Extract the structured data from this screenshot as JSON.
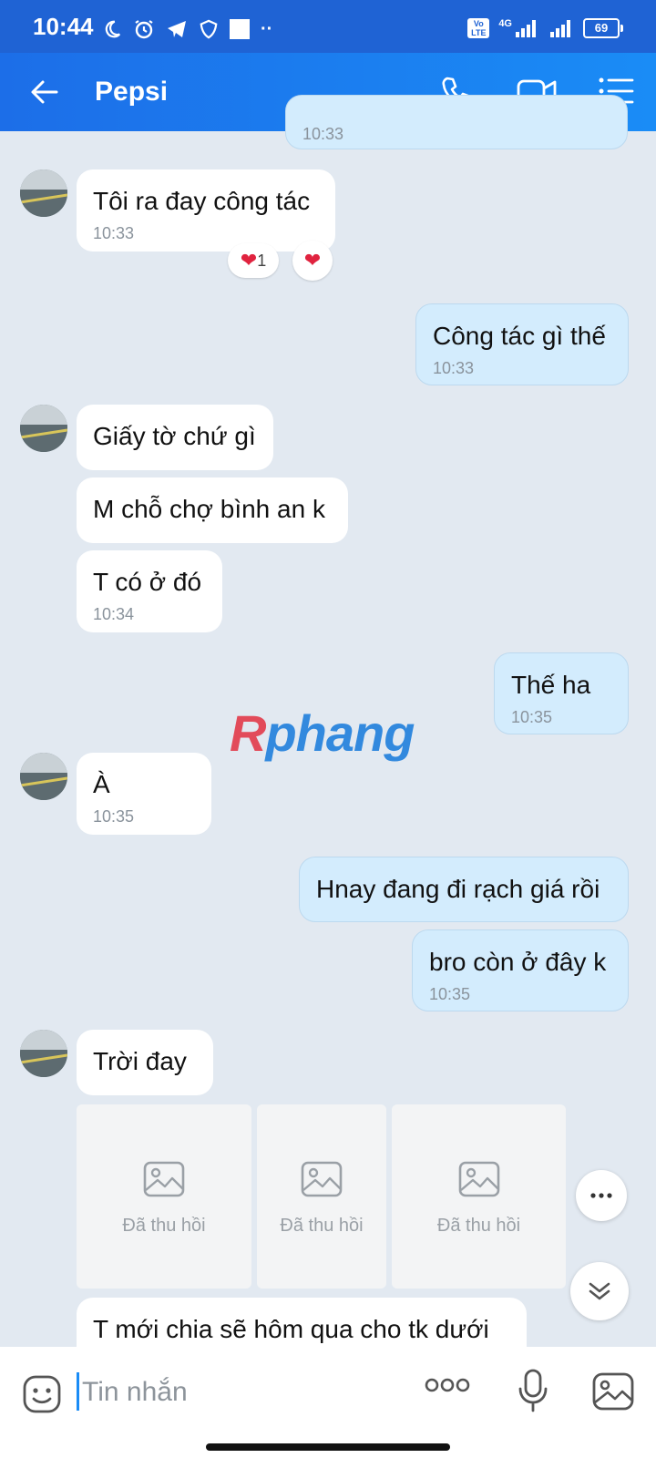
{
  "status_bar": {
    "time": "10:44",
    "volte": "Vo LTE",
    "network": "4G",
    "battery": "69"
  },
  "header": {
    "title": "Pepsi"
  },
  "messages": {
    "m0": {
      "time": "10:33"
    },
    "m1": {
      "text": "Tôi ra đay công tác",
      "time": "10:33",
      "reaction_count": "1"
    },
    "m2": {
      "text": "Công tác gì thế",
      "time": "10:33"
    },
    "m3": {
      "text": "Giấy tờ chứ gì"
    },
    "m4": {
      "text": "M chỗ chợ bình an k"
    },
    "m5": {
      "text": "T có ở đó",
      "time": "10:34"
    },
    "m6": {
      "text": "Thế ha",
      "time": "10:35"
    },
    "m7": {
      "text": "À",
      "time": "10:35"
    },
    "m8": {
      "text": "Hnay đang đi rạch giá rồi"
    },
    "m9": {
      "text": "bro còn ở đây k",
      "time": "10:35"
    },
    "m10": {
      "text": "Trời đay"
    },
    "m11": {
      "text": "T mới chia sẽ hôm qua cho tk dưới"
    }
  },
  "recalled_images": [
    "Đã thu hồi",
    "Đã thu hồi",
    "Đã thu hồi"
  ],
  "watermark": {
    "a": "R",
    "b": "phang"
  },
  "composer": {
    "placeholder": "Tin nhắn",
    "value": ""
  },
  "colors": {
    "accent": "#1a8cf6",
    "header": "#1c6ee8",
    "outgoing_bubble": "#d3ecfd",
    "incoming_bubble": "#ffffff",
    "chat_bg": "#e2e9f1"
  },
  "icons": [
    "back-arrow-icon",
    "phone-icon",
    "video-icon",
    "menu-icon",
    "heart-icon",
    "image-icon",
    "more-icon",
    "chevron-down-icon",
    "emoji-icon",
    "mic-icon",
    "gallery-icon"
  ]
}
